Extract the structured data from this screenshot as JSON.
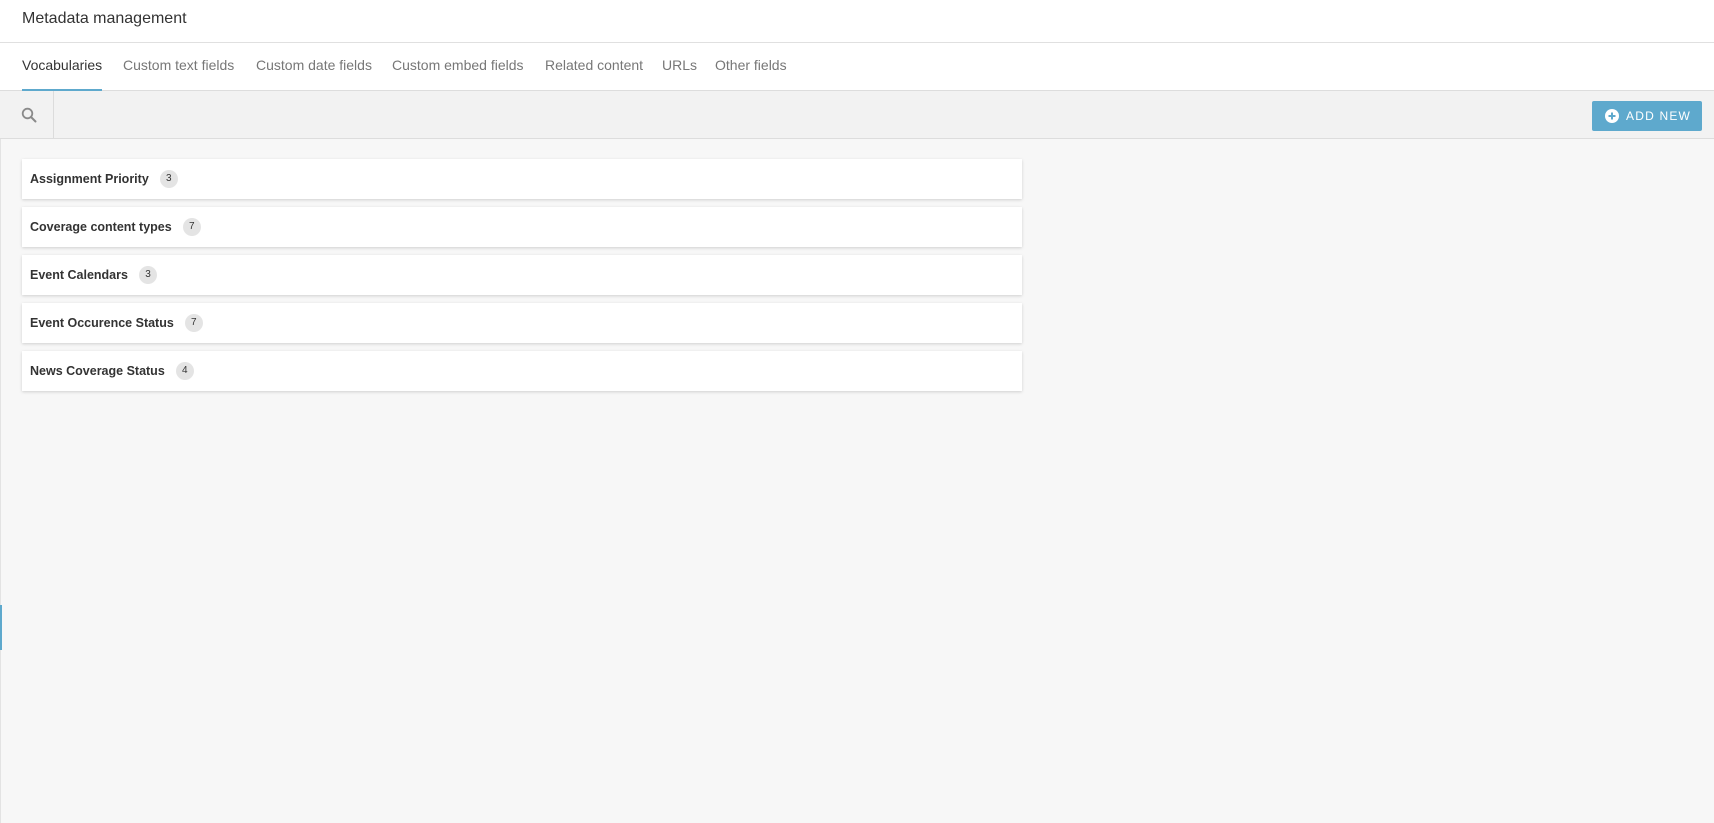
{
  "header": {
    "title": "Metadata management"
  },
  "tabs": [
    {
      "label": "Vocabularies",
      "active": true
    },
    {
      "label": "Custom text fields",
      "active": false
    },
    {
      "label": "Custom date fields",
      "active": false
    },
    {
      "label": "Custom embed fields",
      "active": false
    },
    {
      "label": "Related content",
      "active": false
    },
    {
      "label": "URLs",
      "active": false
    },
    {
      "label": "Other fields",
      "active": false
    }
  ],
  "toolbar": {
    "search_icon": "search-icon",
    "add_new_label": "ADD NEW",
    "add_new_icon": "plus-circle-icon"
  },
  "vocabularies": [
    {
      "name": "Assignment Priority",
      "count": "3"
    },
    {
      "name": "Coverage content types",
      "count": "7"
    },
    {
      "name": "Event Calendars",
      "count": "3"
    },
    {
      "name": "Event Occurence Status",
      "count": "7"
    },
    {
      "name": "News Coverage Status",
      "count": "4"
    }
  ],
  "colors": {
    "accent": "#5ea9cd",
    "background": "#f7f7f7",
    "badge": "#e4e4e4"
  }
}
